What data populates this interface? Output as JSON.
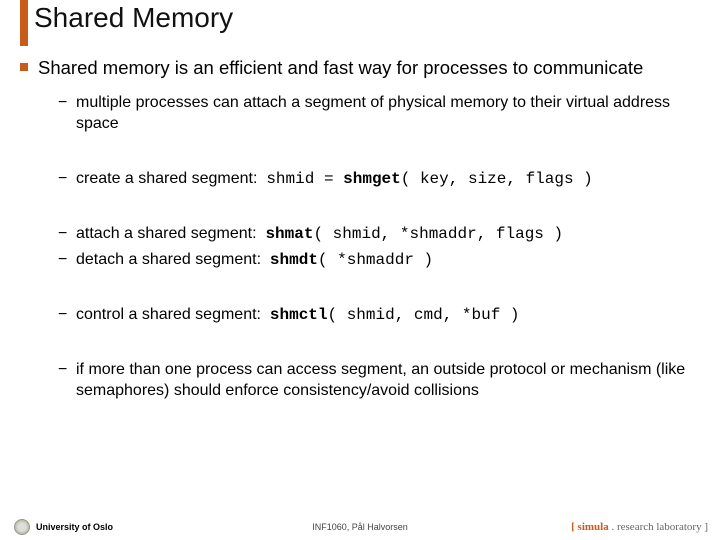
{
  "title": "Shared Memory",
  "main_bullet": "Shared memory is an efficient and fast way for processes to communicate",
  "subs": {
    "a": "multiple processes can attach a segment of physical memory to their virtual address space",
    "b_label": "create a shared segment:",
    "b_code_pre": "shmid = ",
    "b_code_fn": "shmget",
    "b_code_post": "( key, size, flags )",
    "c_label": "attach a shared segment:",
    "c_code_fn": "shmat",
    "c_code_post": "( shmid, *shmaddr, flags )",
    "d_label": "detach a shared segment:",
    "d_code_fn": "shmdt",
    "d_code_post": "( *shmaddr )",
    "e_label": "control a shared segment:",
    "e_code_fn": "shmctl",
    "e_code_post": "( shmid, cmd, *buf )",
    "f": "if more than one process can access segment, an outside protocol or mechanism (like semaphores) should enforce consistency/avoid collisions"
  },
  "footer": {
    "left": "University of Oslo",
    "center": "INF1060, Pål Halvorsen",
    "right_brace_open": "[ ",
    "right_brand": "simula",
    "right_rest": " . research laboratory ]"
  }
}
